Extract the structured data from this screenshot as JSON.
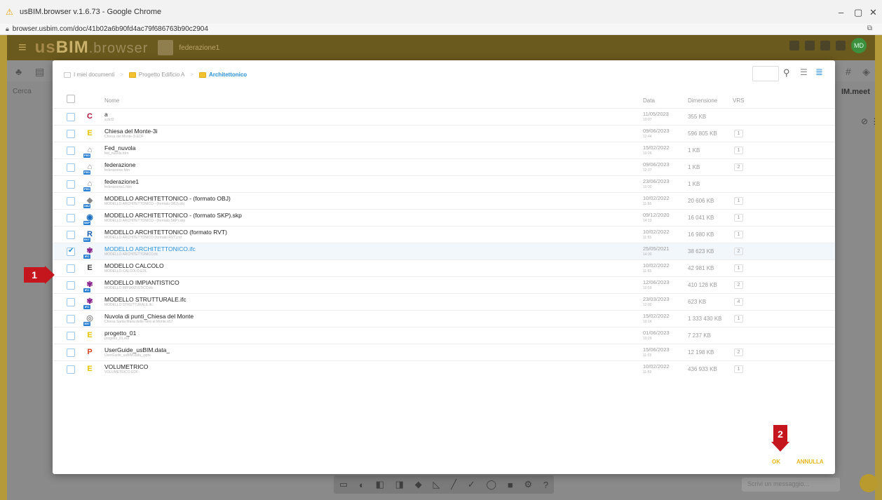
{
  "browser": {
    "title": "usBIM.browser v.1.6.73 - Google Chrome",
    "url": "browser.usbim.com/doc/41b02a6b90fd4ac79f686763b90c2904",
    "minimize": "–",
    "maximize": "▢",
    "close": "✕"
  },
  "app": {
    "logo_us": "us",
    "logo_bim": "BIM",
    "logo_browser": ".browser",
    "header_title": "federazione1",
    "avatar": "MD",
    "search_placeholder": "Cerca",
    "meet_label": "IM.meet",
    "bottom_input_placeholder": "Scrivi un messaggio..."
  },
  "modal": {
    "breadcrumb": [
      "I miei documenti",
      "Progetto Edificio A",
      "Architettonico"
    ],
    "columns": {
      "name": "Nome",
      "date": "Data",
      "size": "Dimensione",
      "vrs": "VRS"
    },
    "ok_label": "OK",
    "cancel_label": "ANNULLA",
    "files": [
      {
        "name": "a",
        "sub": "a.dcf2",
        "date": "11/05/2023",
        "time": "10:07",
        "size": "355 KB",
        "vrs": "",
        "icon": "C",
        "color": "#b0163a",
        "tag": "",
        "selected": false
      },
      {
        "name": "Chiesa del Monte-3i",
        "sub": "Chiesa del Monte-3i.EDF",
        "date": "09/06/2023",
        "time": "12:44",
        "size": "596 805 KB",
        "vrs": "1",
        "icon": "E",
        "color": "#e8c300",
        "tag": "",
        "selected": false
      },
      {
        "name": "Fed_nuvola",
        "sub": "fed_nuvola.fdrn",
        "date": "15/02/2022",
        "time": "10:26",
        "size": "1 KB",
        "vrs": "1",
        "icon": "⌂",
        "color": "#8a8a8a",
        "tag": "FED",
        "selected": false
      },
      {
        "name": "federazione",
        "sub": "federazione.fdrn",
        "date": "09/06/2023",
        "time": "12:37",
        "size": "1 KB",
        "vrs": "2",
        "icon": "⌂",
        "color": "#8a8a8a",
        "tag": "FED",
        "selected": false
      },
      {
        "name": "federazione1",
        "sub": "federazione1.fdrn",
        "date": "23/06/2023",
        "time": "10:30",
        "size": "1 KB",
        "vrs": "",
        "icon": "⌂",
        "color": "#8a8a8a",
        "tag": "FED",
        "selected": false
      },
      {
        "name": "MODELLO ARCHITETTONICO - (formato OBJ)",
        "sub": "MODELLO ARCHITETTONICO - (formato OBJ).obj",
        "date": "10/02/2022",
        "time": "11:56",
        "size": "20 606 KB",
        "vrs": "1",
        "icon": "◆",
        "color": "#8a8a8a",
        "tag": "OBJ",
        "selected": false
      },
      {
        "name": "MODELLO ARCHITETTONICO - (formato SKP).skp",
        "sub": "MODELLO ARCHITETTONICO - (formato SKP).skp",
        "date": "09/12/2020",
        "time": "14:13",
        "size": "16 041 KB",
        "vrs": "1",
        "icon": "◉",
        "color": "#1a6fc0",
        "tag": "SKP",
        "selected": false
      },
      {
        "name": "MODELLO ARCHITETTONICO (formato RVT)",
        "sub": "MODELLO ARCHITETTONICO (formato RVT).rvt",
        "date": "10/02/2022",
        "time": "11:55",
        "size": "16 980 KB",
        "vrs": "1",
        "icon": "R",
        "color": "#1a5fb0",
        "tag": "RVT",
        "selected": false
      },
      {
        "name": "MODELLO ARCHITETTONICO.ifc",
        "sub": "MODELLO ARCHITETTONICO.ifc",
        "date": "25/05/2021",
        "time": "14:30",
        "size": "38 623 KB",
        "vrs": "2",
        "icon": "✾",
        "color": "#8a2a8f",
        "tag": "IFC",
        "selected": true
      },
      {
        "name": "MODELLO CALCOLO",
        "sub": "MODELLO CALCOLO.EDL",
        "date": "10/02/2022",
        "time": "11:55",
        "size": "42 981 KB",
        "vrs": "1",
        "icon": "E",
        "color": "#444444",
        "tag": "",
        "selected": false
      },
      {
        "name": "MODELLO IMPIANTISTICO",
        "sub": "MODELLO IMPIANTISTICO.ifc",
        "date": "12/06/2023",
        "time": "10:59",
        "size": "410 128 KB",
        "vrs": "2",
        "icon": "✾",
        "color": "#8a2a8f",
        "tag": "IFC",
        "selected": false
      },
      {
        "name": "MODELLO STRUTTURALE.ifc",
        "sub": "MODELLO STRUTTURALE.ifc",
        "date": "23/03/2023",
        "time": "12:00",
        "size": "623 KB",
        "vrs": "4",
        "icon": "✾",
        "color": "#8a2a8f",
        "tag": "IFC",
        "selected": false
      },
      {
        "name": "Nuvola di punti_Chiesa del Monte",
        "sub": "Chiesa Santa Maria delle Nevi al Monte.e57",
        "date": "15/02/2022",
        "time": "10:14",
        "size": "1 333 430 KB",
        "vrs": "1",
        "icon": "◎",
        "color": "#8a8a8a",
        "tag": "E57",
        "selected": false
      },
      {
        "name": "progetto_01",
        "sub": "progetto_01.edf",
        "date": "01/06/2023",
        "time": "10:29",
        "size": "7 237 KB",
        "vrs": "",
        "icon": "E",
        "color": "#e8c300",
        "tag": "",
        "selected": false
      },
      {
        "name": "UserGuide_usBIM.data_",
        "sub": "UserGuide_usBIM.data_.pptx",
        "date": "15/06/2023",
        "time": "11:03",
        "size": "12 198 KB",
        "vrs": "2",
        "icon": "P",
        "color": "#d14424",
        "tag": "",
        "selected": false
      },
      {
        "name": "VOLUMETRICO",
        "sub": "VOLUMETRICO.EDF",
        "date": "10/02/2022",
        "time": "11:59",
        "size": "436 933 KB",
        "vrs": "1",
        "icon": "E",
        "color": "#e8c300",
        "tag": "",
        "selected": false
      }
    ]
  },
  "markers": {
    "step1": "1",
    "step2": "2"
  }
}
